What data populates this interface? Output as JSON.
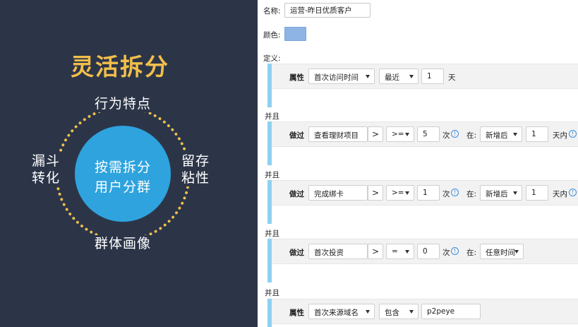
{
  "promo": {
    "title": "灵活拆分",
    "center_line1": "按需拆分",
    "center_line2": "用户分群",
    "label_top": "行为特点",
    "label_bottom": "群体画像",
    "label_left_1": "漏斗",
    "label_left_2": "转化",
    "label_right_1": "留存",
    "label_right_2": "粘性",
    "colors": {
      "background": "#2c3548",
      "title": "#f2bf4a",
      "ring": "#f0c04c",
      "core": "#2ea3de"
    }
  },
  "editor": {
    "name_label": "名称:",
    "name_value": "运营-昨日优质客户",
    "color_label": "颜色:",
    "color_value": "#8eb4e6",
    "definition_label": "定义:",
    "and_label": "并且",
    "arrow_glyph": ">",
    "info_glyph": "!",
    "conditions": [
      {
        "kind": "属性",
        "field": "首次访问时间",
        "op": "最近",
        "value": "1",
        "unit": "天"
      },
      {
        "kind": "做过",
        "field": "查看理财项目",
        "op": ">=",
        "value": "5",
        "unit": "次",
        "in_label": "在:",
        "range": "新增后",
        "range_value": "1",
        "range_unit": "天内"
      },
      {
        "kind": "做过",
        "field": "完成绑卡",
        "op": ">=",
        "value": "1",
        "unit": "次",
        "in_label": "在:",
        "range": "新增后",
        "range_value": "1",
        "range_unit": "天内"
      },
      {
        "kind": "做过",
        "field": "首次投资",
        "op": "=",
        "value": "0",
        "unit": "次",
        "in_label": "在:",
        "range": "任意时间"
      },
      {
        "kind": "属性",
        "field": "首次来源域名",
        "op": "包含",
        "value": "p2peye"
      }
    ]
  }
}
